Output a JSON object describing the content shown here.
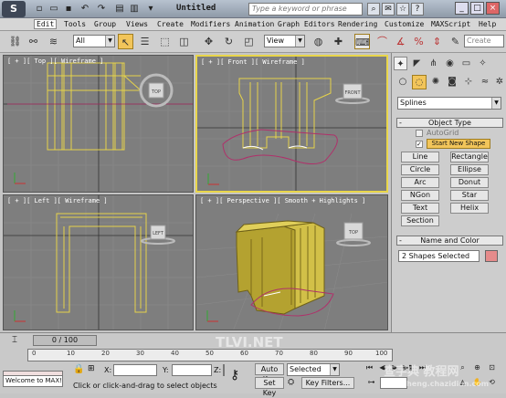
{
  "app": {
    "logo_glyph": "S",
    "document_title": "Untitled",
    "search_placeholder": "Type a keyword or phrase"
  },
  "menu": [
    "Edit",
    "Tools",
    "Group",
    "Views",
    "Create",
    "Modifiers",
    "Animation",
    "Graph Editors",
    "Rendering",
    "Customize",
    "MAXScript",
    "Help"
  ],
  "toolbar": {
    "selection_filter": "All",
    "reference_coord": "View",
    "create_selection_set": "Create"
  },
  "viewports": {
    "top": "[ + ][ Top ][ Wireframe ]",
    "front": "[ + ][ Front ][ Wireframe ]",
    "left": "[ + ][ Left ][ Wireframe ]",
    "perspective": "[ + ][ Perspective ][ Smooth + Highlights ]",
    "viewcube_top": "TOP",
    "viewcube_front": "FRONT",
    "viewcube_left": "LEFT",
    "viewcube_persp": "TOP"
  },
  "command_panel": {
    "category": "Splines",
    "object_type_title": "Object Type",
    "autogrid": "AutoGrid",
    "start_new_shape": "Start New Shape",
    "buttons": [
      "Line",
      "Rectangle",
      "Circle",
      "Ellipse",
      "Arc",
      "Donut",
      "NGon",
      "Star",
      "Text",
      "Helix",
      "Section"
    ],
    "name_color_title": "Name and Color",
    "selection_name": "2 Shapes Selected",
    "swatch_color": "#e58b8b"
  },
  "timeline": {
    "frame_range": "0 / 100",
    "ticks": [
      "0",
      "10",
      "20",
      "30",
      "40",
      "50",
      "60",
      "70",
      "80",
      "90",
      "100"
    ]
  },
  "status": {
    "listener_text": "Welcome to MAX!",
    "prompt": "Click or click-and-drag to select objects",
    "x_label": "X:",
    "y_label": "Y:",
    "z_label": "Z:",
    "auto_key": "Auto Key",
    "set_key": "Set Key",
    "key_mode": "Selected",
    "key_filters": "Key Filters..."
  },
  "watermarks": {
    "site": "TLVI.NET",
    "brand": "查字典 教程网",
    "url": "jiaocheng.chazidian.com"
  }
}
